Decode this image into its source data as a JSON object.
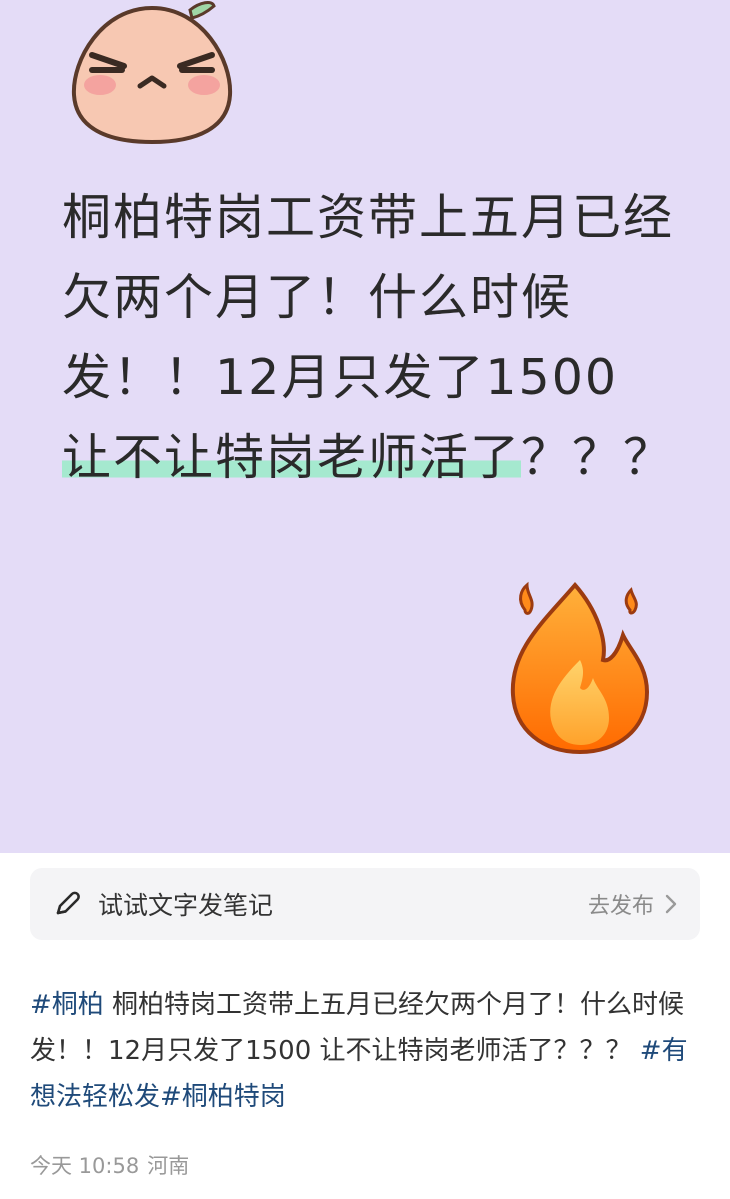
{
  "card": {
    "headline_part1": "桐柏特岗工资带上五月已经欠两个月了！什么时候发！！12月只发了1500 ",
    "headline_highlight": "让不让特岗老师活了",
    "headline_part2": "？？？",
    "mascot_icon": "angry-peach-mascot-icon",
    "fire_icon": "fire-emoji-icon",
    "background_color": "#e4dcf7",
    "highlight_color": "#a5e9cf"
  },
  "prompt_bar": {
    "icon": "pencil-icon",
    "text": "试试文字发笔记",
    "action_label": "去发布",
    "action_icon": "chevron-right-icon"
  },
  "post": {
    "tag1": "#桐柏",
    "body": " 桐柏特岗工资带上五月已经欠两个月了！什么时候发！！12月只发了1500 让不让特岗老师活了？？？ ",
    "tag2": "#有想法轻松发",
    "tag3": "#桐柏特岗",
    "tag_color": "#1f4a7a"
  },
  "meta": {
    "time": "今天 10:58",
    "location": "河南"
  }
}
